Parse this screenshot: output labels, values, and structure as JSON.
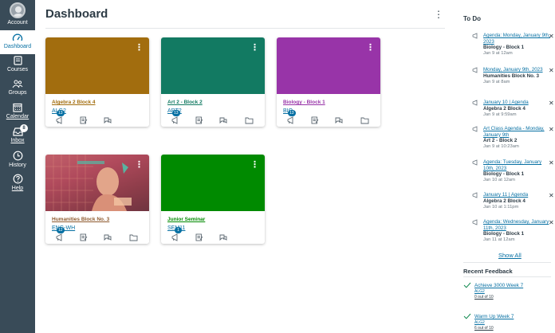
{
  "nav": {
    "account": "Account",
    "dashboard": "Dashboard",
    "courses": "Courses",
    "groups": "Groups",
    "calendar": "Calendar",
    "inbox": "Inbox",
    "inbox_badge": "8",
    "history": "History",
    "help": "Help"
  },
  "header": {
    "title": "Dashboard",
    "menu": "⋮"
  },
  "cards": [
    {
      "title": "Algebra 2 Block 4",
      "code": "ALG2",
      "badge": "13",
      "color": "#A26D0E"
    },
    {
      "title": "Art 2 - Block 2",
      "code": "ART2",
      "badge": "13",
      "color": "#127A62"
    },
    {
      "title": "Biology - Block 1",
      "code": "BIO",
      "badge": "13",
      "color": "#9834A8"
    },
    {
      "title": "Humanities Block No. 3",
      "code": "ENG-WH",
      "badge": "12",
      "color": "#8E5A2E"
    },
    {
      "title": "Junior Seminar",
      "code": "SEM11",
      "badge": "1",
      "color": "#008A00"
    }
  ],
  "todo": {
    "title": "To Do",
    "items": [
      {
        "link": "Agenda: Monday, January 9th, 2023",
        "course": "Biology - Block 1",
        "date": "Jan 9 at 12am"
      },
      {
        "link": "Monday, January 9th, 2023",
        "course": "Humanities Block No. 3",
        "date": "Jan 9 at 8am"
      },
      {
        "link": "January 10 | Agenda",
        "course": "Algebra 2 Block 4",
        "date": "Jan 9 at 9:59am"
      },
      {
        "link": "Art Class Agenda - Monday, January 9th",
        "course": "Art 2 - Block 2",
        "date": "Jan 9 at 10:23am"
      },
      {
        "link": "Agenda: Tuesday, January 10th, 2023",
        "course": "Biology - Block 1",
        "date": "Jan 10 at 12am"
      },
      {
        "link": "January 11 | Agenda",
        "course": "Algebra 2 Block 4",
        "date": "Jan 10 at 1:11pm"
      },
      {
        "link": "Agenda: Wednesday, January 11th, 2023",
        "course": "Biology - Block 1",
        "date": "Jan 11 at 12am"
      }
    ],
    "show_all": "Show All"
  },
  "feedback": {
    "title": "Recent Feedback",
    "items": [
      {
        "link": "Achieve 3000 Week 7",
        "course": "ALG2",
        "score": "0 out of 10"
      },
      {
        "link": "Warm Up Week 7",
        "course": "ALG2",
        "score": "6 out of 10"
      }
    ]
  },
  "colors": {
    "nav_bg": "#394B58",
    "link": "#0770A3",
    "text": "#2D3B45"
  }
}
